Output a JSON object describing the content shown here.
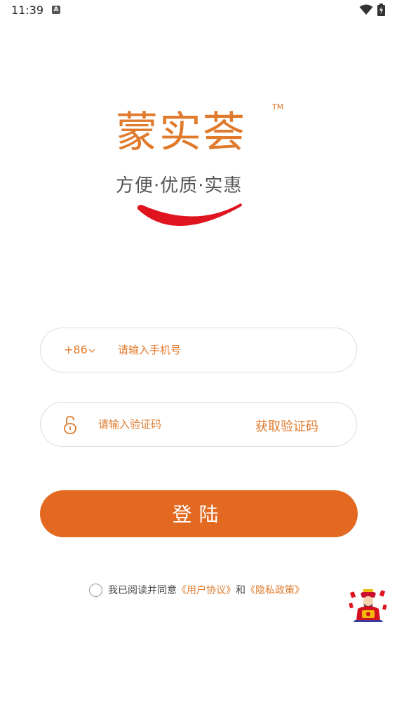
{
  "status_bar": {
    "time": "11:39",
    "notification_icon": "a-icon",
    "wifi_icon": "wifi-icon",
    "battery_icon": "battery-charging-icon"
  },
  "logo": {
    "title": "蒙实荟",
    "trademark": "TM",
    "slogan": "方便·优质·实惠",
    "brand_color": "#e07a2c",
    "smile_color": "#e0141e"
  },
  "phone_field": {
    "country_code": "+86",
    "placeholder": "请输入手机号",
    "value": ""
  },
  "code_field": {
    "placeholder": "请输入验证码",
    "value": "",
    "get_code_label": "获取验证码",
    "icon": "lock-icon"
  },
  "login_button": {
    "label": "登陆",
    "color": "#e2691f"
  },
  "agreement": {
    "checked": false,
    "prefix": "我已阅读并同意",
    "user_agreement": "《用户协议》",
    "conjunction": "和",
    "privacy_policy": "《隐私政策》"
  },
  "mascot": {
    "icon": "god-of-wealth-icon"
  }
}
